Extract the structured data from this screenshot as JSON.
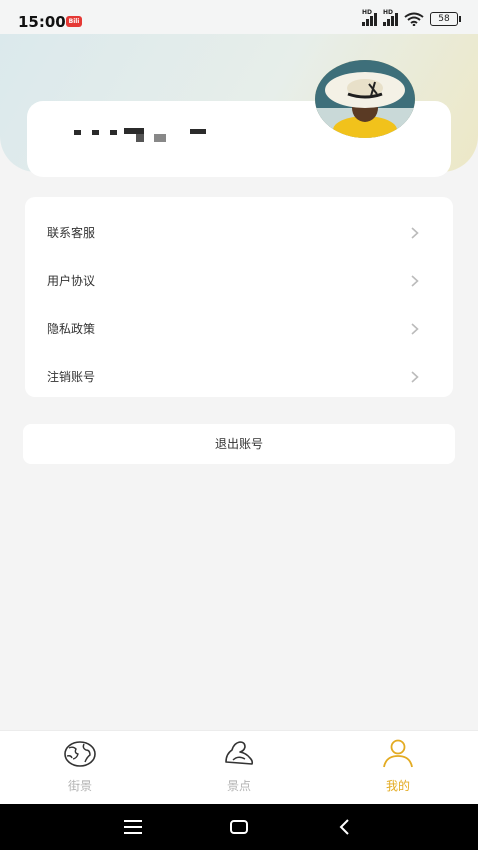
{
  "status_bar": {
    "time": "15:00",
    "badge": "Bili",
    "battery": "58"
  },
  "profile": {
    "username_masked": true
  },
  "menu": {
    "items": [
      {
        "label": "联系客服"
      },
      {
        "label": "用户协议"
      },
      {
        "label": "隐私政策"
      },
      {
        "label": "注销账号"
      }
    ]
  },
  "logout_label": "退出账号",
  "tabbar": {
    "tabs": [
      {
        "label": "街景",
        "icon": "globe-icon",
        "active": false
      },
      {
        "label": "景点",
        "icon": "mountain-icon",
        "active": false
      },
      {
        "label": "我的",
        "icon": "person-icon",
        "active": true
      }
    ]
  },
  "colors": {
    "accent": "#e3ab22",
    "inactive": "#b3b3b3",
    "background": "#f4f4f4"
  }
}
